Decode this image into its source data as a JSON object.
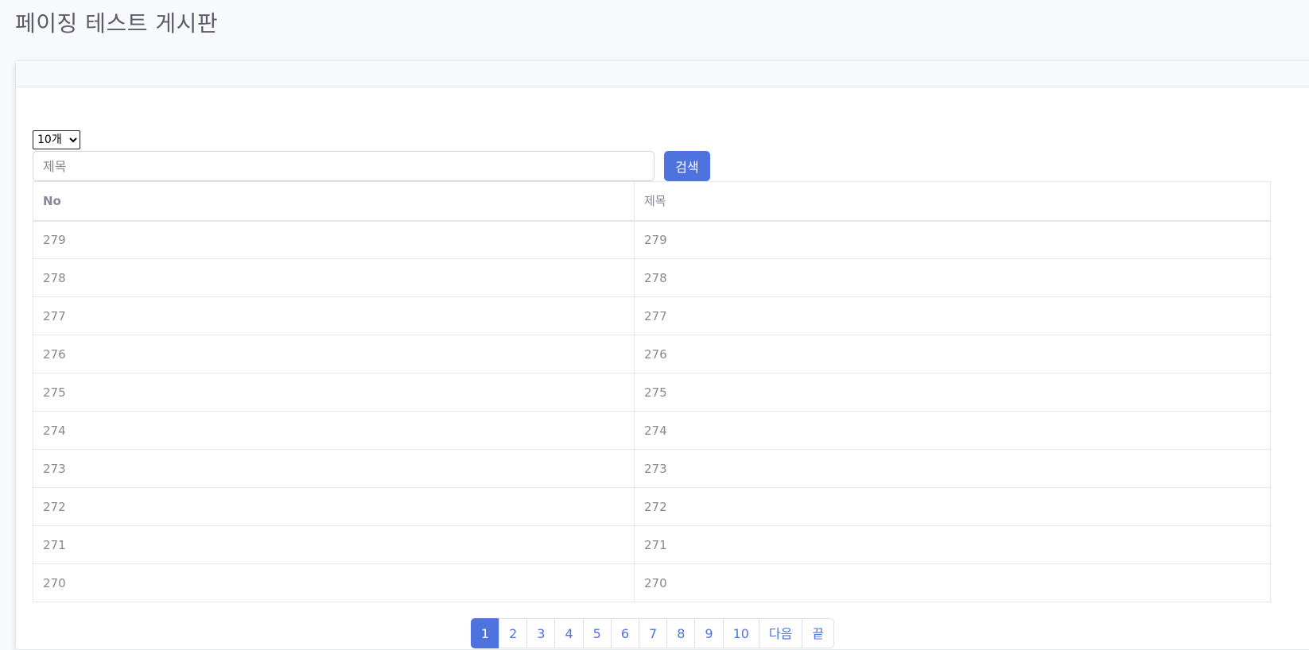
{
  "page": {
    "title": "페이징 테스트 게시판"
  },
  "controls": {
    "page_size": {
      "selected": "10개",
      "options": [
        "10개"
      ]
    },
    "search": {
      "placeholder": "제목",
      "value": "",
      "button_label": "검색"
    }
  },
  "table": {
    "columns": [
      "No",
      "제목"
    ],
    "rows": [
      [
        "279",
        "279"
      ],
      [
        "278",
        "278"
      ],
      [
        "277",
        "277"
      ],
      [
        "276",
        "276"
      ],
      [
        "275",
        "275"
      ],
      [
        "274",
        "274"
      ],
      [
        "273",
        "273"
      ],
      [
        "272",
        "272"
      ],
      [
        "271",
        "271"
      ],
      [
        "270",
        "270"
      ]
    ]
  },
  "pagination": {
    "active": "1",
    "pages": [
      "1",
      "2",
      "3",
      "4",
      "5",
      "6",
      "7",
      "8",
      "9",
      "10",
      "다음",
      "끝"
    ]
  },
  "colors": {
    "primary": "#4e73df",
    "text_muted": "#858796",
    "heading": "#5a5c69",
    "border": "#e3e6f0",
    "background": "#f8f9fc"
  }
}
